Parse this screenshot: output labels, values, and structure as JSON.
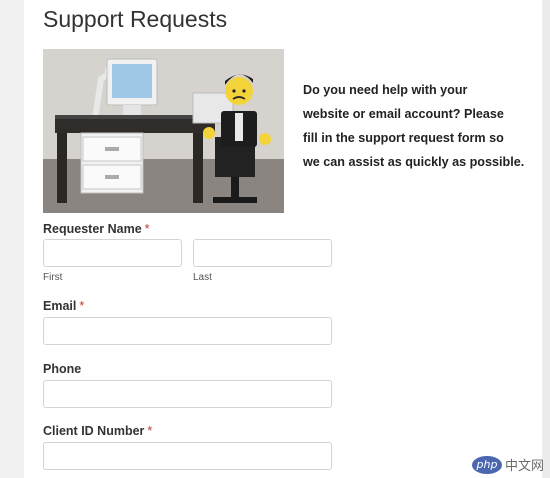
{
  "page": {
    "title": "Support Requests",
    "image_alt": "support photo: lego figure at desk"
  },
  "intro": {
    "lines": [
      "Do you need help with your",
      "website or email account? Please",
      "fill in the support request form so",
      "we can assist as quickly as possible."
    ]
  },
  "form": {
    "requester_name": {
      "label": "Requester Name",
      "required_mark": "*",
      "first_sublabel": "First",
      "last_sublabel": "Last"
    },
    "email": {
      "label": "Email",
      "required_mark": "*"
    },
    "phone": {
      "label": "Phone"
    },
    "client_id": {
      "label": "Client ID Number",
      "required_mark": "*"
    }
  },
  "watermark": {
    "logo": "php",
    "text": "中文网"
  },
  "colors": {
    "required": "#c0392b",
    "brand_watermark": "#4a67b0"
  }
}
